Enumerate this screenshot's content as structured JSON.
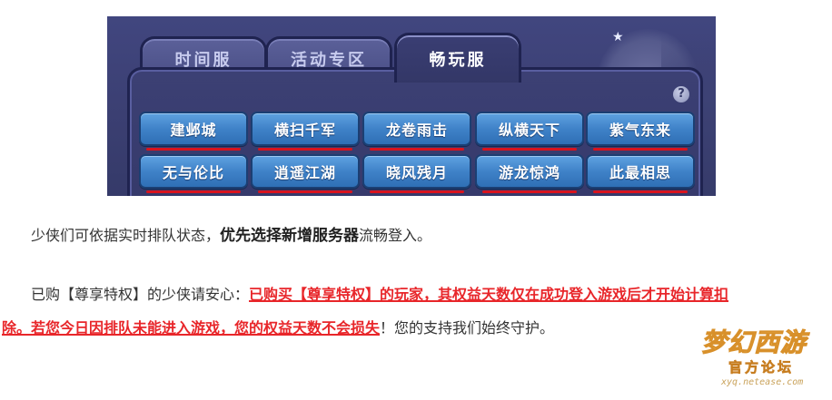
{
  "game_panel": {
    "tabs": [
      {
        "label": "时间服",
        "active": false
      },
      {
        "label": "活动专区",
        "active": false
      },
      {
        "label": "畅玩服",
        "active": true
      }
    ],
    "help_icon": "?",
    "servers_row1": [
      "建邺城",
      "横扫千军",
      "龙卷雨击",
      "纵横天下",
      "紫气东来"
    ],
    "servers_row2": [
      "无与伦比",
      "逍遥江湖",
      "晓风残月",
      "游龙惊鸿",
      "此最相思"
    ],
    "underline_color": "#d8141e",
    "button_color": "#3f82c8"
  },
  "article": {
    "p1_before": "少侠们可依据实时排队状态，",
    "p1_bold": "优先选择新增服务器",
    "p1_after": "流畅登入。",
    "p2_before": "已购【尊享特权】的少侠请安心：",
    "p2_red": "已购买【尊享特权】的玩家，其权益天数仅在成功登入游戏后才开始计算扣",
    "p3_red": "除。若您今日因排队未能进入游戏，您的权益天数不会损失",
    "p3_after": "！您的支持我们始终守护。",
    "red_color": "#e8262a"
  },
  "logo": {
    "title": "梦幻西游",
    "subtitle": "官方论坛",
    "url": "xyq.netease.com"
  }
}
